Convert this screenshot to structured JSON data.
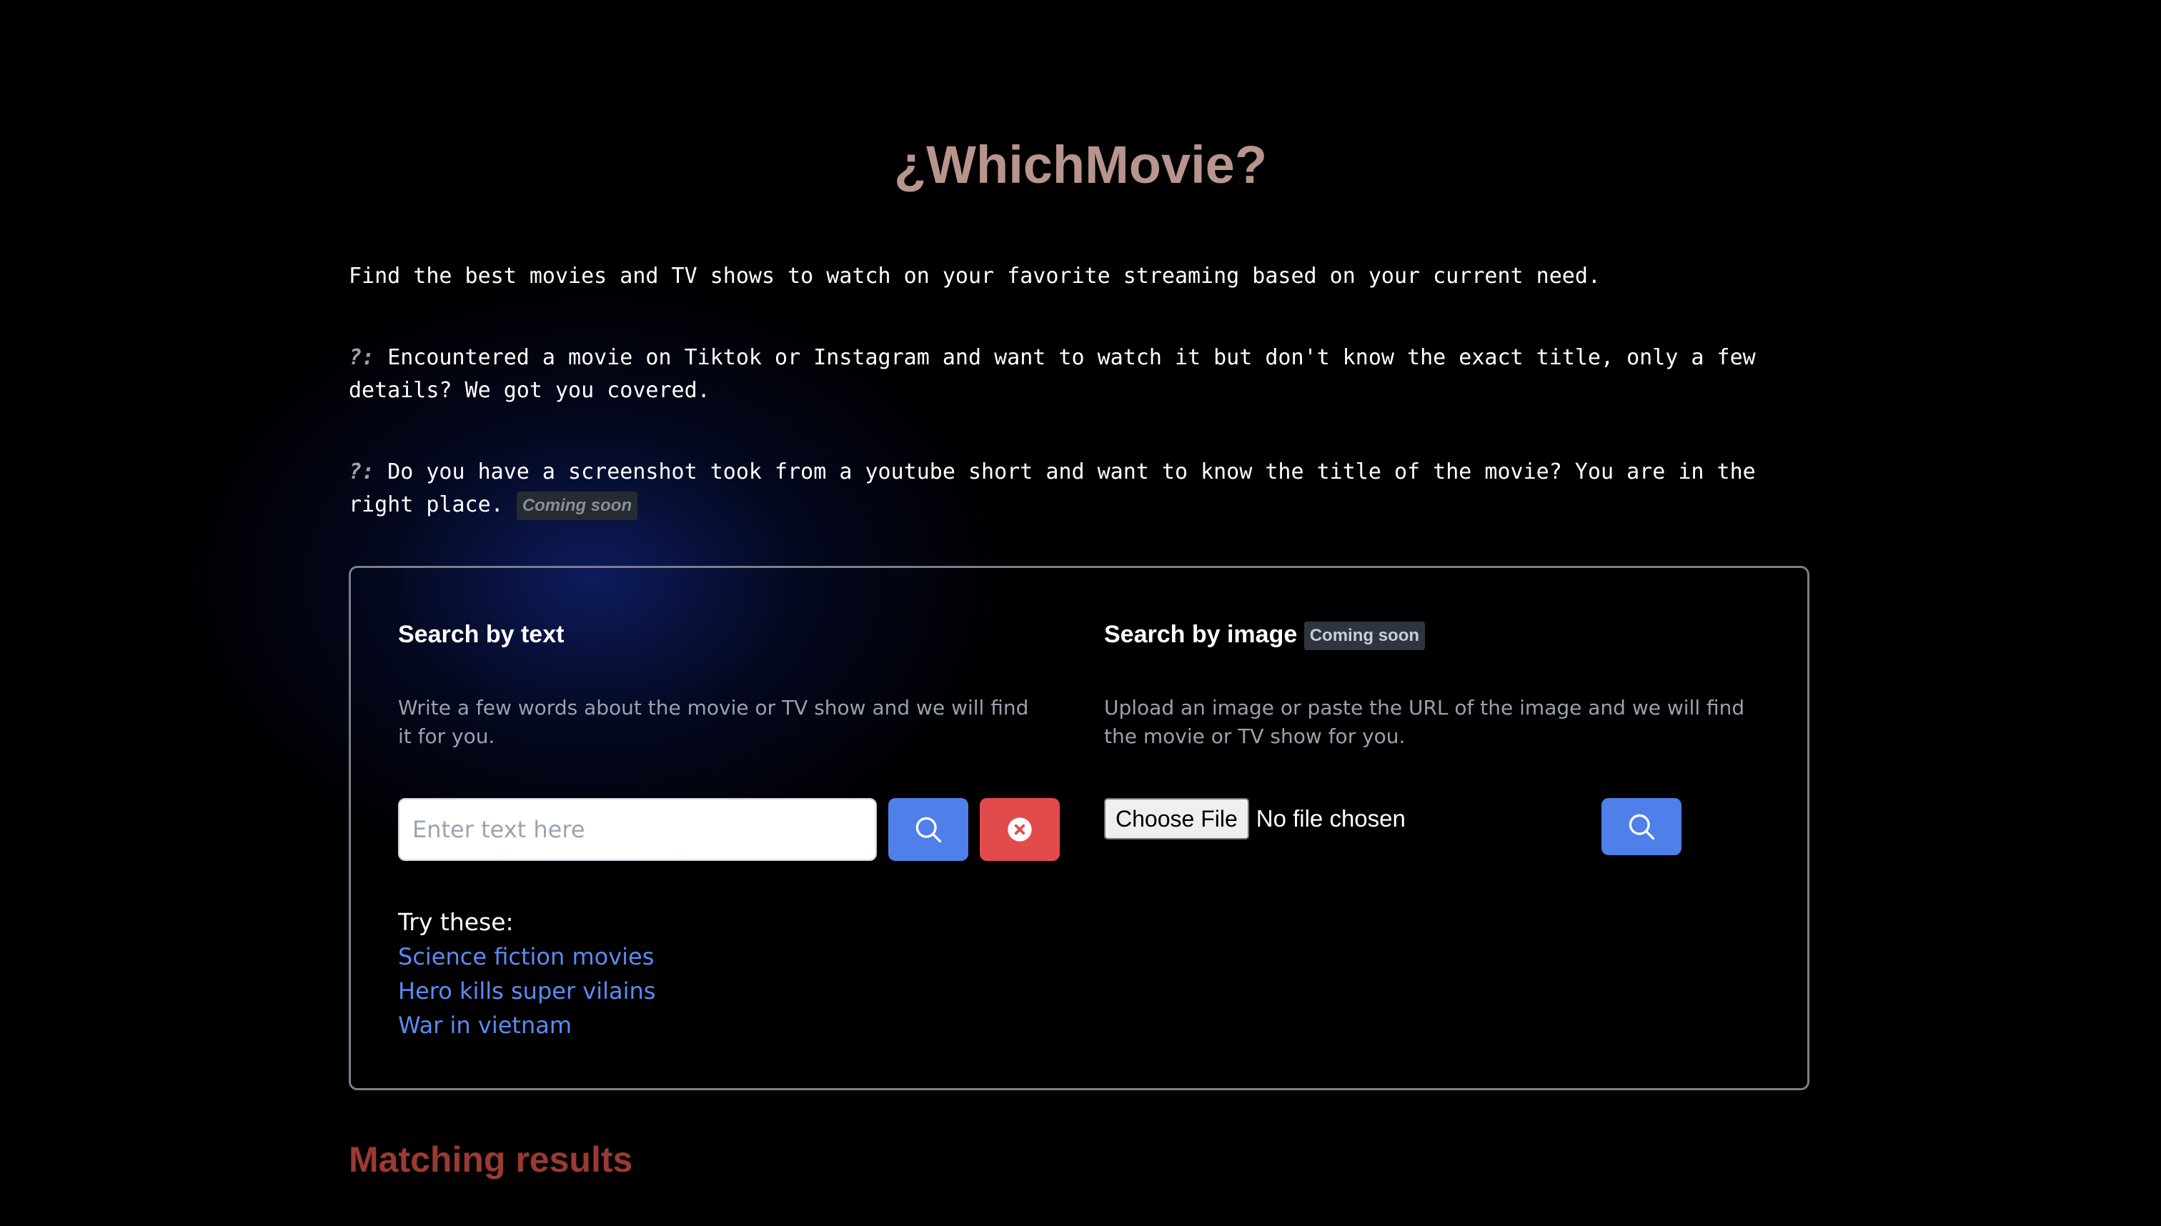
{
  "header": {
    "title": "¿WhichMovie?"
  },
  "intro": {
    "text": "Find the best movies and TV shows to watch on your favorite streaming based on your current need.",
    "marker": "?:",
    "point1": "Encountered a movie on Tiktok or Instagram and want to watch it but don't know the exact title, only a few details? We got you covered.",
    "point2": "Do you have a screenshot took from a youtube short and want to know the title of the movie? You are in the right place.",
    "point2_badge": "Coming soon"
  },
  "search_text": {
    "title": "Search by text",
    "description": "Write a few words about the movie or TV show and we will find it for you.",
    "placeholder": "Enter text here",
    "value": "",
    "search_icon": "search-icon",
    "clear_icon": "close-circle-icon",
    "try_label": "Try these:",
    "suggestions": [
      "Science fiction movies",
      "Hero kills super vilains",
      "War in vietnam"
    ]
  },
  "search_image": {
    "title": "Search by image",
    "badge": "Coming soon",
    "description": "Upload an image or paste the URL of the image and we will find the movie or TV show for you.",
    "file_button": "Choose File",
    "file_status": "No file chosen",
    "search_icon": "search-icon"
  },
  "results": {
    "title": "Matching results"
  },
  "colors": {
    "background": "#000000",
    "title": "#b8958c",
    "primary_button": "#4f7fe8",
    "danger_button": "#e24b4b",
    "link": "#5b8bf5",
    "results_title": "#9b3a32",
    "panel_border": "#7a7f88"
  }
}
